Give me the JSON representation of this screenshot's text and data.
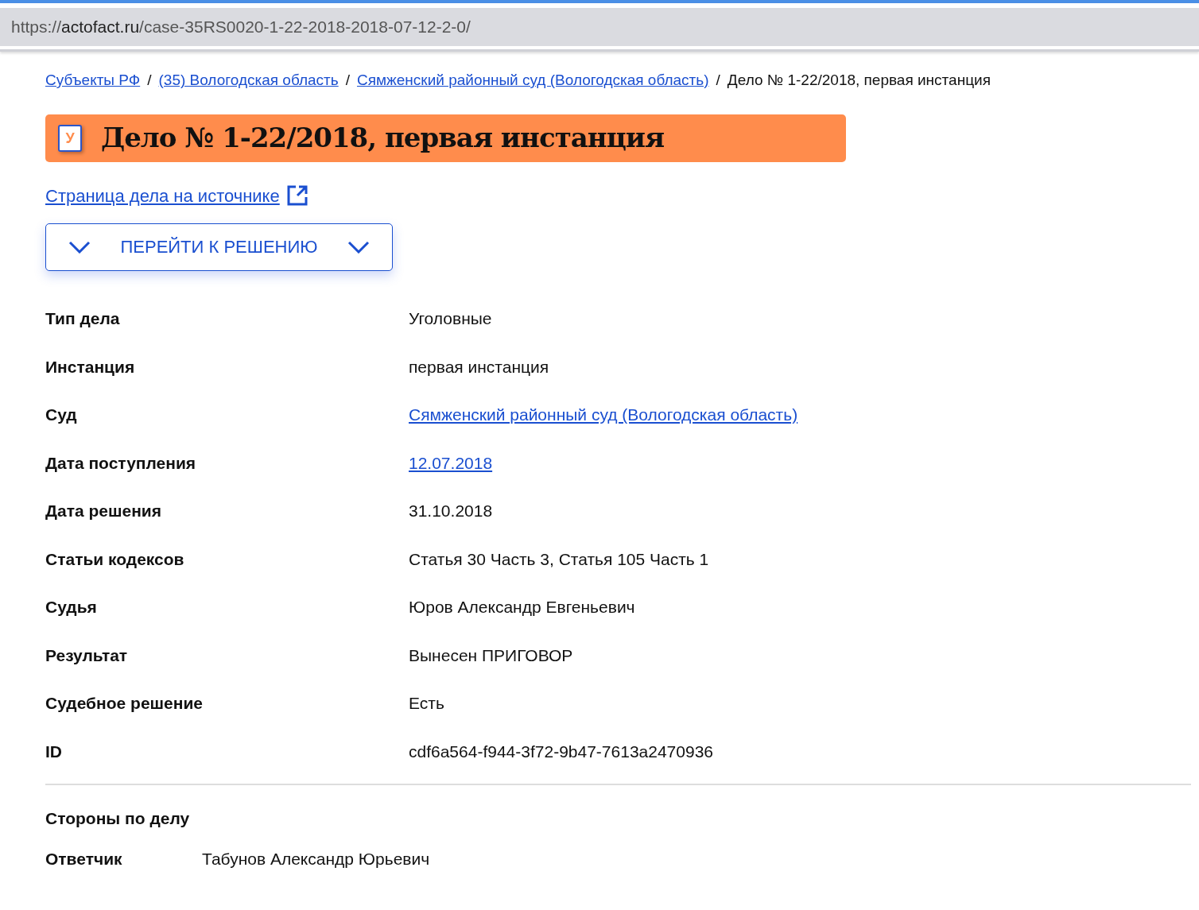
{
  "address_bar": {
    "scheme": "https://",
    "host": "actofact.ru",
    "path": "/case-35RS0020-1-22-2018-2018-07-12-2-0/"
  },
  "breadcrumb_separator": "/",
  "breadcrumbs": [
    {
      "label": "Субъекты РФ",
      "kind": "link"
    },
    {
      "label": "(35) Вологодская область",
      "kind": "link"
    },
    {
      "label": "Сямженский районный суд (Вологодская область)",
      "kind": "link"
    },
    {
      "label": "Дело № 1-22/2018, первая инстанция",
      "kind": "text"
    }
  ],
  "title": {
    "badge_letter": "У",
    "text": "Дело № 1-22/2018, первая инстанция"
  },
  "source_link": "Страница дела на источнике",
  "jump_button": "ПЕРЕЙТИ К РЕШЕНИЮ",
  "details": [
    {
      "label": "Тип дела",
      "value": "Уголовные",
      "kind": "text"
    },
    {
      "label": "Инстанция",
      "value": "первая инстанция",
      "kind": "text"
    },
    {
      "label": "Суд",
      "value": "Сямженский районный суд (Вологодская область)",
      "kind": "link"
    },
    {
      "label": "Дата поступления",
      "value": "12.07.2018",
      "kind": "link"
    },
    {
      "label": "Дата решения",
      "value": "31.10.2018",
      "kind": "text"
    },
    {
      "label": "Статьи кодексов",
      "value": "Статья 30 Часть 3, Статья 105 Часть 1",
      "kind": "text"
    },
    {
      "label": "Судья",
      "value": "Юров Александр Евгеньевич",
      "kind": "text"
    },
    {
      "label": "Результат",
      "value": "Вынесен ПРИГОВОР",
      "kind": "text"
    },
    {
      "label": "Судебное решение",
      "value": "Есть",
      "kind": "text"
    },
    {
      "label": "ID",
      "value": "cdf6a564-f944-3f72-9b47-7613a2470936",
      "kind": "text"
    }
  ],
  "parties": {
    "heading": "Стороны по делу",
    "items": [
      {
        "role": "Ответчик",
        "name": "Табунов Александр Юрьевич"
      }
    ]
  }
}
